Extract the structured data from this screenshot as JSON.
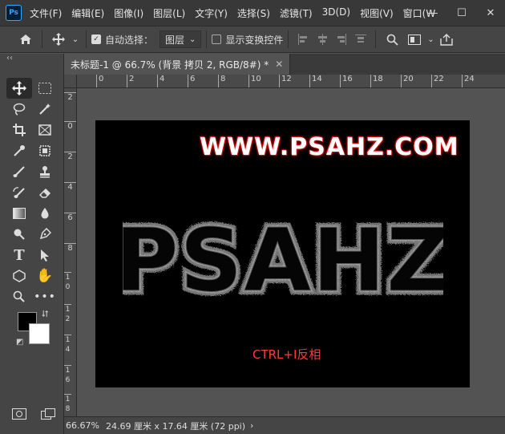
{
  "app": {
    "logo": "Ps"
  },
  "menu": [
    "文件(F)",
    "编辑(E)",
    "图像(I)",
    "图层(L)",
    "文字(Y)",
    "选择(S)",
    "滤镜(T)",
    "3D(D)",
    "视图(V)",
    "窗口(W"
  ],
  "window_controls": {
    "minimize": "—",
    "maximize": "☐",
    "close": "✕"
  },
  "options_bar": {
    "auto_select_label": "自动选择：",
    "auto_select_checked": true,
    "auto_select_target": "图层",
    "show_transform_label": "显示变换控件",
    "show_transform_checked": false
  },
  "document_tab": {
    "title": "未标题-1 @ 66.7% (背景 拷贝 2, RGB/8#) *",
    "close": "✕"
  },
  "toolbar": {
    "collapse": "‹‹"
  },
  "ruler": {
    "top_ticks": [
      "0",
      "2",
      "4",
      "6",
      "8",
      "10",
      "12",
      "14",
      "16",
      "18",
      "20",
      "22",
      "24"
    ],
    "left_ticks": [
      "2",
      "0",
      "2",
      "4",
      "6",
      "8",
      "1 0",
      "1 2",
      "1 4",
      "1 6",
      "1 8"
    ]
  },
  "canvas": {
    "url_text": "WWW.PSAHZ.COM",
    "big_text": "PSAHZ",
    "caption": "CTRL+I反相",
    "accent_color": "#ff3b3b"
  },
  "status": {
    "zoom": "66.67%",
    "doc_size": "24.69 厘米 x 17.64 厘米 (72 ppi)",
    "arrow": "›"
  }
}
